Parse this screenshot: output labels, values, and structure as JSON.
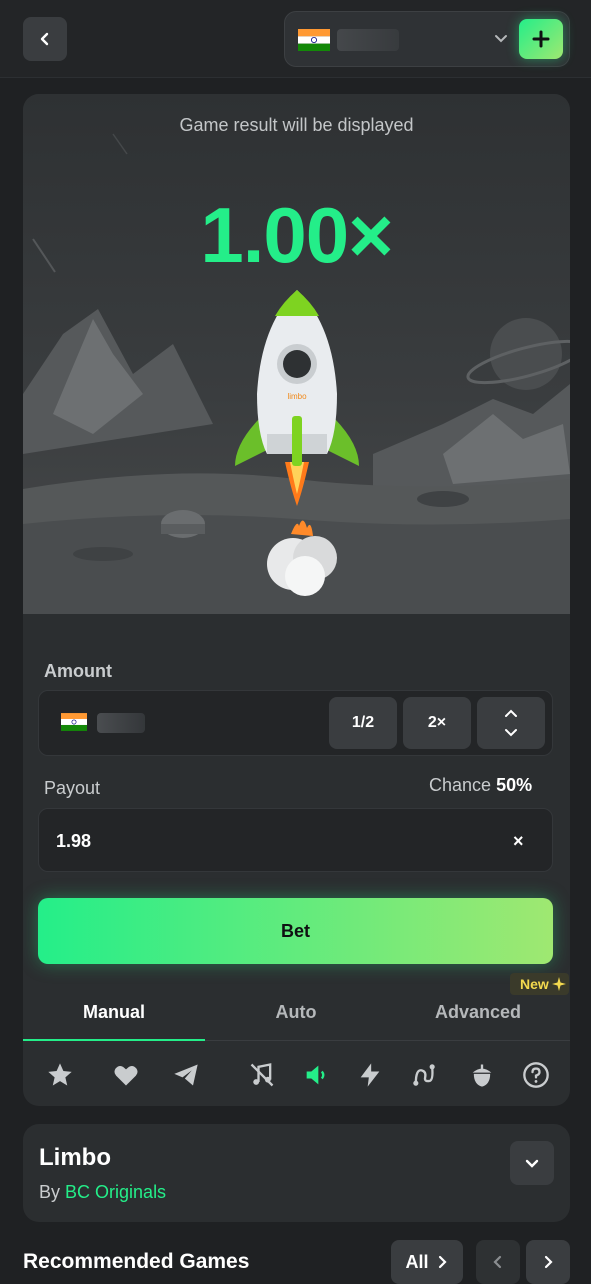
{
  "header": {
    "back_icon": "chevron-left-icon",
    "wallet": {
      "currency_flag": "india-flag",
      "balance_hidden": "",
      "dropdown_icon": "chevron-down-icon",
      "deposit_icon": "plus-icon"
    }
  },
  "game": {
    "result_text": "Game result will be displayed",
    "multiplier": "1.00×",
    "rocket_label": "limbo",
    "colors": {
      "accent": "#24ee89",
      "accent_end": "#9fe871",
      "panel": "#2b2e30"
    }
  },
  "amount": {
    "label": "Amount",
    "half_label": "1/2",
    "double_label": "2×"
  },
  "payout": {
    "label": "Payout",
    "chance_label": "Chance",
    "chance_value": "50%",
    "value": "1.98",
    "suffix": "×"
  },
  "bet_button": {
    "label": "Bet"
  },
  "tabs": [
    {
      "label": "Manual",
      "active": true
    },
    {
      "label": "Auto",
      "active": false
    },
    {
      "label": "Advanced",
      "active": false
    }
  ],
  "new_badge": "New",
  "toolbar_icons": [
    "star-icon",
    "heart-icon",
    "telegram-icon",
    "music-off-icon",
    "speaker-icon",
    "lightning-icon",
    "route-icon",
    "acorn-icon",
    "help-icon"
  ],
  "info": {
    "title": "Limbo",
    "by_label": "By",
    "provider": "BC Originals"
  },
  "recommended": {
    "title": "Recommended Games",
    "all_label": "All"
  }
}
